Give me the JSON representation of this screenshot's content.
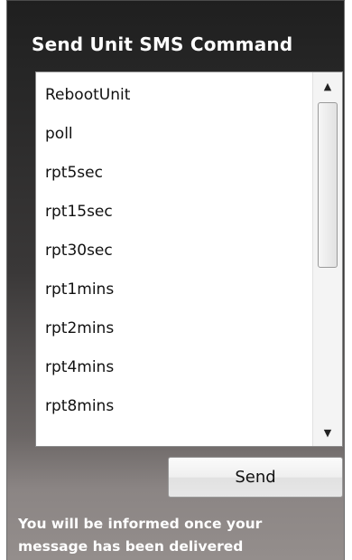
{
  "panel": {
    "title": "Send Unit SMS Command"
  },
  "command_list": {
    "items": [
      "RebootUnit",
      "poll",
      "rpt5sec",
      "rpt15sec",
      "rpt30sec",
      "rpt1mins",
      "rpt2mins",
      "rpt4mins",
      "rpt8mins"
    ],
    "scroll_up_glyph": "▲",
    "scroll_down_glyph": "▼"
  },
  "send_button": {
    "label": "Send"
  },
  "info": {
    "line1": "You will be informed once your",
    "line2": "message has been delivered"
  },
  "colors": {
    "title_text": "#ffffff",
    "panel_top": "#1f1f1f",
    "panel_bottom": "#948e8c"
  }
}
